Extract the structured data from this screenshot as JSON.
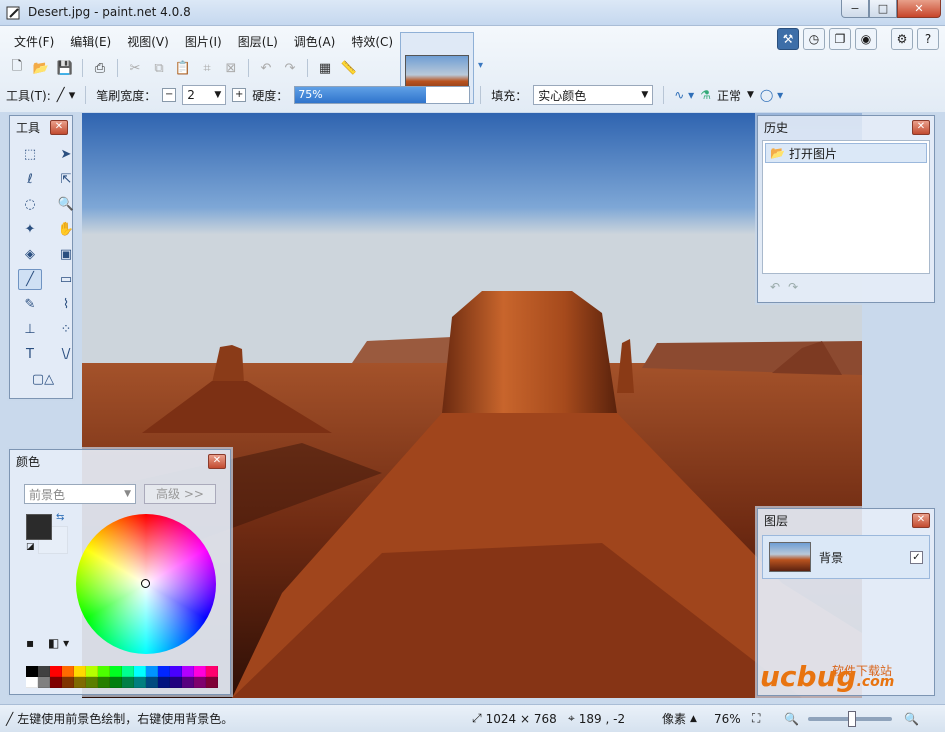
{
  "window": {
    "title": "Desert.jpg - paint.net 4.0.8",
    "min": "−",
    "max": "□",
    "close": "✕"
  },
  "menu": [
    "文件(F)",
    "编辑(E)",
    "视图(V)",
    "图片(I)",
    "图层(L)",
    "调色(A)",
    "特效(C)"
  ],
  "toolbar2": {
    "tool_label": "工具(T):",
    "brush_width_label": "笔刷宽度：",
    "brush_width_value": "2",
    "hardness_label": "硬度：",
    "hardness_value": "75%",
    "hardness_fraction": 0.75,
    "fill_label": "填充：",
    "fill_value": "实心颜色",
    "blend_value": "正常"
  },
  "tools_panel": {
    "title": "工具"
  },
  "history_panel": {
    "title": "历史",
    "items": [
      "打开图片"
    ]
  },
  "layers_panel": {
    "title": "图层",
    "layers": [
      {
        "name": "背景",
        "visible": true
      }
    ]
  },
  "colors_panel": {
    "title": "颜色",
    "target": "前景色",
    "more_button": "高级 >>",
    "primary_color": "#2b2b2b",
    "secondary_color": "#ffffff",
    "palette": [
      "#000000",
      "#404040",
      "#ff0000",
      "#ff6a00",
      "#ffd800",
      "#b6ff00",
      "#4cff00",
      "#00ff21",
      "#00ff90",
      "#00ffff",
      "#0094ff",
      "#0026ff",
      "#4800ff",
      "#b200ff",
      "#ff00dc",
      "#ff006e",
      "#ffffff",
      "#808080",
      "#7f0000",
      "#7f3300",
      "#7f6a00",
      "#5b7f00",
      "#267f00",
      "#007f0e",
      "#007f46",
      "#007f7f",
      "#004a7f",
      "#00137f",
      "#21007f",
      "#57007f",
      "#7f006e",
      "#7f0037"
    ]
  },
  "status": {
    "hint": "左键使用前景色绘制，右键使用背景色。",
    "image_size": "1024 × 768",
    "cursor": "189 , -2",
    "unit": "像素",
    "zoom": "76%"
  },
  "watermark": {
    "brand": "ucbug",
    "suffix": ".com",
    "caption": "软件下载站"
  }
}
